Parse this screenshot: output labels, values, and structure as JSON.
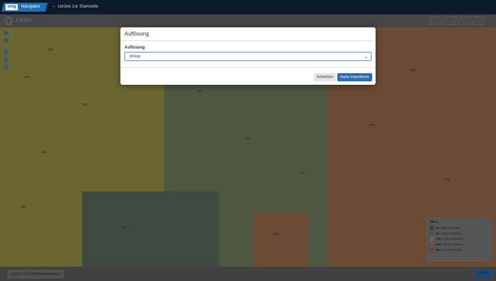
{
  "topbar": {
    "brand_emg": "emg",
    "brand_navigator": "Navigator",
    "back_link": "zurück zur Startseite"
  },
  "page": {
    "title": "Karten"
  },
  "map": {
    "zoom_in": "+",
    "zoom_out": "−",
    "tools": [
      "…",
      "",
      "",
      "…"
    ],
    "labels": [
      "180",
      "50",
      "400"
    ]
  },
  "legend": {
    "title": "Wert",
    "items": [
      {
        "value": "10",
        "detail": "(98 Postorte)",
        "color": "#1d7a25"
      },
      {
        "value": "50",
        "detail": "(286 Postorte)",
        "color": "#8fa17a"
      },
      {
        "value": "180",
        "detail": "(156 Postorte)",
        "color": "#d4d06a"
      },
      {
        "value": "400",
        "detail": "(217 Postorte)",
        "color": "#d6955f"
      },
      {
        "value": "550",
        "detail": "(19 Postorte)",
        "color": "#e0675a"
      }
    ]
  },
  "footer": {
    "back_label": "zurück zur Spaltenzuordnung",
    "next_label": "Weiter"
  },
  "modal": {
    "title": "Auflösung",
    "field_label": "Auflösung",
    "select_value": "300dpi",
    "close_label": "Schließen",
    "export_label": "Karte exportieren"
  }
}
